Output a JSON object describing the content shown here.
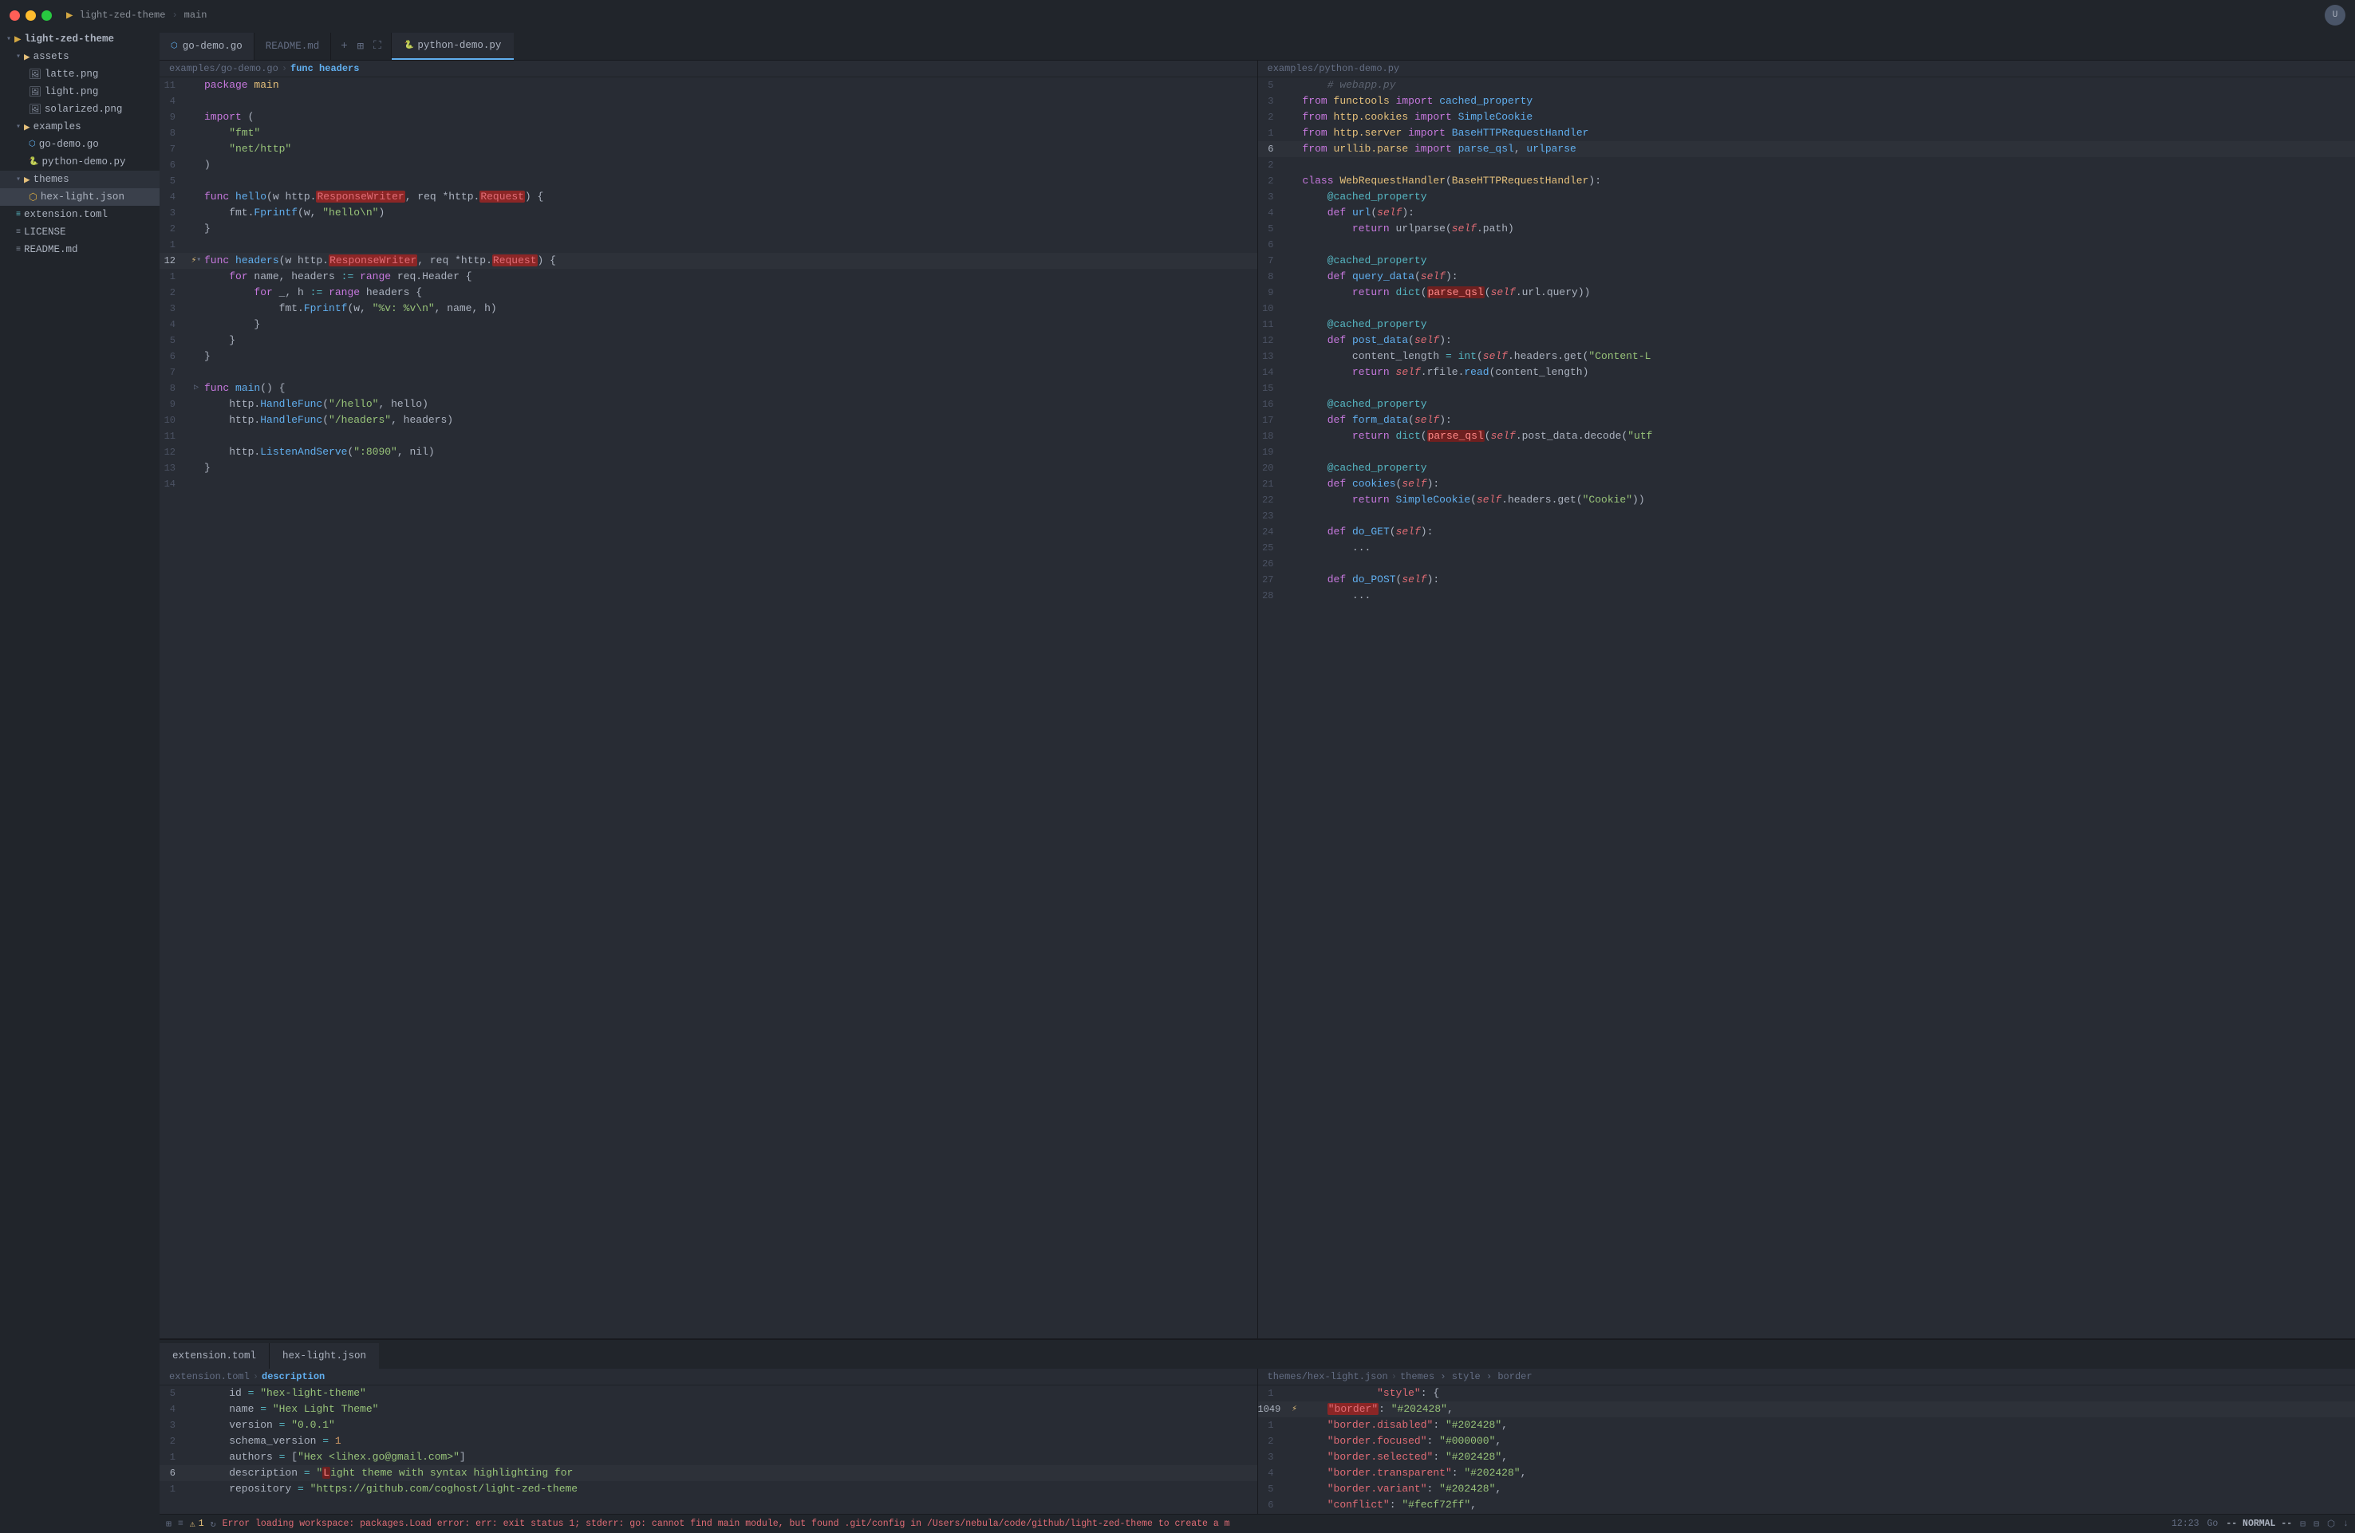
{
  "titlebar": {
    "project_name": "light-zed-theme",
    "branch": "main",
    "avatar_initials": "U"
  },
  "sidebar": {
    "root": "light-zed-theme",
    "items": [
      {
        "id": "assets-folder",
        "label": "assets",
        "type": "folder",
        "indent": 1,
        "open": true
      },
      {
        "id": "latte-png",
        "label": "latte.png",
        "type": "img",
        "indent": 2
      },
      {
        "id": "light-png",
        "label": "light.png",
        "type": "img",
        "indent": 2
      },
      {
        "id": "solarized-png",
        "label": "solarized.png",
        "type": "img",
        "indent": 2
      },
      {
        "id": "examples-folder",
        "label": "examples",
        "type": "folder",
        "indent": 1,
        "open": true
      },
      {
        "id": "go-demo-go",
        "label": "go-demo.go",
        "type": "go",
        "indent": 2
      },
      {
        "id": "python-demo-py",
        "label": "python-demo.py",
        "type": "py",
        "indent": 2
      },
      {
        "id": "themes-folder",
        "label": "themes",
        "type": "folder",
        "indent": 1,
        "open": true,
        "active": true
      },
      {
        "id": "hex-light-json",
        "label": "hex-light.json",
        "type": "json",
        "indent": 2,
        "selected": true
      },
      {
        "id": "extension-toml",
        "label": "extension.toml",
        "type": "toml",
        "indent": 1
      },
      {
        "id": "license",
        "label": "LICENSE",
        "type": "file",
        "indent": 1
      },
      {
        "id": "readme-md",
        "label": "README.md",
        "type": "md",
        "indent": 1
      }
    ]
  },
  "tabs_top": {
    "left": [
      {
        "id": "go-demo",
        "label": "go-demo.go",
        "active": true
      },
      {
        "id": "readme",
        "label": "README.md",
        "active": false
      }
    ],
    "right": [
      {
        "id": "python-demo",
        "label": "python-demo.py",
        "active": true
      }
    ]
  },
  "tabs_bottom": {
    "left": {
      "label": "extension.toml",
      "active": true
    },
    "right": {
      "label": "hex-light.json",
      "active": true
    }
  },
  "breadcrumbs": {
    "go_demo": {
      "file": "examples/go-demo.go",
      "func": "func headers"
    },
    "python_demo": {
      "file": "examples/python-demo.py"
    },
    "extension_toml": {
      "file": "extension.toml",
      "section": "description"
    },
    "hex_light": {
      "file": "themes/hex-light.json",
      "path": "themes › style › border"
    }
  },
  "go_code": [
    {
      "num": 11,
      "gutter": "",
      "content": "package <pkg>main</pkg>"
    },
    {
      "num": 4,
      "gutter": "",
      "content": ""
    },
    {
      "num": 9,
      "gutter": "",
      "content": "<kw>import</kw> <plain>(</plain>"
    },
    {
      "num": 8,
      "gutter": "",
      "content": "    <str>\"fmt\"</str>"
    },
    {
      "num": 7,
      "gutter": "",
      "content": "    <str>\"net/http\"</str>"
    },
    {
      "num": 6,
      "gutter": "",
      "content": "<plain>)</plain>"
    },
    {
      "num": 5,
      "gutter": "",
      "content": ""
    },
    {
      "num": 4,
      "gutter": "",
      "content": "<kw>func</kw> <fn-def>hello</fn-def><plain>(w http.</plain><highlight-red>ResponseWriter</highlight-red><plain>, req *http.</plain><highlight-red>Request</highlight-red><plain>) {</plain>"
    },
    {
      "num": 3,
      "gutter": "",
      "content": "    fmt.<fn>Fprintf</fn><plain>(w, </plain><str>\"hello\\n\"</str><plain>)</plain>"
    },
    {
      "num": 2,
      "gutter": "",
      "content": "<plain>}</plain>"
    },
    {
      "num": 1,
      "gutter": "",
      "content": ""
    },
    {
      "num": 12,
      "gutter": "⚡▾",
      "content": "<kw>func</kw> <fn-def>headers</fn-def><plain>(w http.</plain><highlight-red>ResponseWriter</highlight-red><plain>, req *http.</plain><highlight-red>Request</highlight-red><plain>) {</plain>",
      "current": true
    },
    {
      "num": 1,
      "gutter": "",
      "content": "    <kw>for</kw> name, headers <op>:=</op> <kw>range</kw> req.Header {"
    },
    {
      "num": 2,
      "gutter": "",
      "content": "        <kw>for</kw> _, h <op>:=</op> <kw>range</kw> headers {"
    },
    {
      "num": 3,
      "gutter": "",
      "content": "            fmt.<fn>Fprintf</fn><plain>(w, </plain><str>\"%v: %v\\n\"</str><plain>, name, h)</plain>"
    },
    {
      "num": 4,
      "gutter": "",
      "content": "        <plain>}</plain>"
    },
    {
      "num": 5,
      "gutter": "",
      "content": "    <plain>}</plain>"
    },
    {
      "num": 6,
      "gutter": "",
      "content": "<plain>}</plain>"
    },
    {
      "num": 7,
      "gutter": "",
      "content": ""
    },
    {
      "num": 8,
      "gutter": "▷",
      "content": "<kw>func</kw> <fn-def>main</fn-def><plain>() {</plain>"
    },
    {
      "num": 9,
      "gutter": "",
      "content": "    http.<fn>HandleFunc</fn><plain>(</plain><str>\"/hello\"</str><plain>, hello)</plain>"
    },
    {
      "num": 10,
      "gutter": "",
      "content": "    http.<fn>HandleFunc</fn><plain>(</plain><str>\"/headers\"</str><plain>, headers)</plain>"
    },
    {
      "num": 11,
      "gutter": "",
      "content": ""
    },
    {
      "num": 12,
      "gutter": "",
      "content": "    http.<fn>ListenAndServe</fn><plain>(</plain><str>\":8090\"</str><plain>, nil)</plain>"
    },
    {
      "num": 13,
      "gutter": "",
      "content": "<plain>}</plain>"
    },
    {
      "num": 14,
      "gutter": "",
      "content": ""
    }
  ],
  "python_code": [
    {
      "num": 5,
      "content": "    <comment># webapp.py</comment>"
    },
    {
      "num": 3,
      "content": "<kw>from</kw> <pkg>functools</pkg> <kw>import</kw> <fn>cached_property</fn>"
    },
    {
      "num": 2,
      "content": "<kw>from</kw> <pkg>http.cookies</pkg> <kw>import</kw> <fn>SimpleCookie</fn>"
    },
    {
      "num": 1,
      "content": "<kw>from</kw> <pkg>http.server</pkg> <kw>import</kw> <fn>BaseHTTPRequestHandler</fn>"
    },
    {
      "num": 6,
      "content": "<kw>from</kw> <pkg>urllib.parse</pkg> <kw>import</kw> <fn>parse_qsl</fn><plain>, </plain><fn>urlparse</fn>",
      "current": true
    },
    {
      "num": 2,
      "content": ""
    },
    {
      "num": 2,
      "content": "<kw>class</kw> <type>WebRequestHandler</type><plain>(</plain><type>BaseHTTPRequestHandler</type><plain>):</plain>"
    },
    {
      "num": 3,
      "content": "    <decorator>@cached_property</decorator>"
    },
    {
      "num": 4,
      "content": "    <kw>def</kw> <method>url</method><plain>(</plain><self-kw>self</self-kw><plain>):</plain>"
    },
    {
      "num": 5,
      "content": "        <kw>return</kw> urlparse<plain>(</plain><self-kw>self</self-kw><plain>.path)</plain>"
    },
    {
      "num": 6,
      "content": ""
    },
    {
      "num": 7,
      "content": "    <decorator>@cached_property</decorator>"
    },
    {
      "num": 8,
      "content": "    <kw>def</kw> <method>query_data</method><plain>(</plain><self-kw>self</self-kw><plain>):</plain>"
    },
    {
      "num": 9,
      "content": "        <kw>return</kw> <builtin>dict</builtin><plain>(</plain><highlight-red2>parse_qsl</highlight-red2><plain>(</plain><self-kw>self</self-kw><plain>.url.query))</plain>"
    },
    {
      "num": 10,
      "content": ""
    },
    {
      "num": 11,
      "content": "    <decorator>@cached_property</decorator>"
    },
    {
      "num": 12,
      "content": "    <kw>def</kw> <method>post_data</method><plain>(</plain><self-kw>self</self-kw><plain>):</plain>"
    },
    {
      "num": 13,
      "content": "        content_length <op>=</op> <builtin>int</builtin><plain>(</plain><self-kw>self</self-kw><plain>.headers.get(</plain><str>\"Content-L</str>"
    },
    {
      "num": 14,
      "content": "        <kw>return</kw> <self-kw>self</self-kw><plain>.rfile.</plain><method>read</method><plain>(content_length)</plain>"
    },
    {
      "num": 15,
      "content": ""
    },
    {
      "num": 16,
      "content": "    <decorator>@cached_property</decorator>"
    },
    {
      "num": 17,
      "content": "    <kw>def</kw> <method>form_data</method><plain>(</plain><self-kw>self</self-kw><plain>):</plain>"
    },
    {
      "num": 18,
      "content": "        <kw>return</kw> <builtin>dict</builtin><plain>(</plain><highlight-red2>parse_qsl</highlight-red2><plain>(</plain><self-kw>self</self-kw><plain>.post_data.decode(</plain><str>\"utf</str>"
    },
    {
      "num": 19,
      "content": ""
    },
    {
      "num": 20,
      "content": "    <decorator>@cached_property</decorator>"
    },
    {
      "num": 21,
      "content": "    <kw>def</kw> <method>cookies</method><plain>(</plain><self-kw>self</self-kw><plain>):</plain>"
    },
    {
      "num": 22,
      "content": "        <kw>return</kw> <fn>SimpleCookie</fn><plain>(</plain><self-kw>self</self-kw><plain>.headers.get(</plain><str>\"Cookie\"</str><plain>))</plain>"
    },
    {
      "num": 23,
      "content": ""
    },
    {
      "num": 24,
      "content": "    <kw>def</kw> <method>do_GET</method><plain>(</plain><self-kw>self</self-kw><plain>):</plain>"
    },
    {
      "num": 25,
      "content": "        <plain>...</plain>"
    },
    {
      "num": 26,
      "content": ""
    },
    {
      "num": 27,
      "content": "    <kw>def</kw> <method>do_POST</method><plain>(</plain><self-kw>self</self-kw><plain>):</plain>"
    },
    {
      "num": 28,
      "content": "        <plain>...</plain>"
    }
  ],
  "toml_code": [
    {
      "num": 5,
      "content": "    id <op>=</op> <str>\"hex-light-theme\"</str>"
    },
    {
      "num": 4,
      "content": "    name <op>=</op> <str>\"Hex Light Theme\"</str>"
    },
    {
      "num": 3,
      "content": "    version <op>=</op> <str>\"0.0.1\"</str>"
    },
    {
      "num": 2,
      "content": "    schema_version <op>=</op> <num>1</num>"
    },
    {
      "num": 1,
      "content": "    authors <op>=</op> <plain>[</plain><str>\"Hex &lt;lihex.go@gmail.com&gt;\"</str><plain>]</plain>"
    },
    {
      "num": 6,
      "content": "    description <op>=</op> <str>\"Light theme with syntax highlighting for</str>",
      "current": true
    },
    {
      "num": 1,
      "content": "    repository <op>=</op> <str>\"https://github.com/coghost/light-zed-theme</str>"
    }
  ],
  "json_code": [
    {
      "num": 1,
      "content": "            <str>\"style\"</str><plain>: {</plain>"
    },
    {
      "num": 1049,
      "content": "    <json-key>\"border\"</json-key><plain>: </plain><str>\"#202428\"</str><plain>,</plain>",
      "current": true,
      "lightning": true
    },
    {
      "num": 1,
      "content": "    <json-key>\"border.disabled\"</json-key><plain>: </plain><str>\"#202428\"</str><plain>,</plain>"
    },
    {
      "num": 2,
      "content": "    <json-key>\"border.focused\"</json-key><plain>: </plain><str>\"#000000\"</str><plain>,</plain>"
    },
    {
      "num": 3,
      "content": "    <json-key>\"border.selected\"</json-key><plain>: </plain><str>\"#202428\"</str><plain>,</plain>"
    },
    {
      "num": 4,
      "content": "    <json-key>\"border.transparent\"</json-key><plain>: </plain><str>\"#202428\"</str><plain>,</plain>"
    },
    {
      "num": 5,
      "content": "    <json-key>\"border.variant\"</json-key><plain>: </plain><str>\"#202428\"</str><plain>,</plain>"
    },
    {
      "num": 6,
      "content": "    <json-key>\"conflict\"</json-key><plain>: </plain><str>\"#fecf72ff\"</str><plain>,</plain>"
    }
  ],
  "status_bar": {
    "branch_icon": "⌥",
    "diagnostics_icon": "⊟",
    "errors": "1",
    "reload_icon": "↻",
    "error_message": "Error loading workspace: packages.Load error: err: exit status 1; stderr: go: cannot find main module, but found .git/config in /Users/nebula/code/github/light-zed-theme to create a m",
    "time": "12:23",
    "mode": "-- NORMAL --",
    "lang": "Go"
  }
}
